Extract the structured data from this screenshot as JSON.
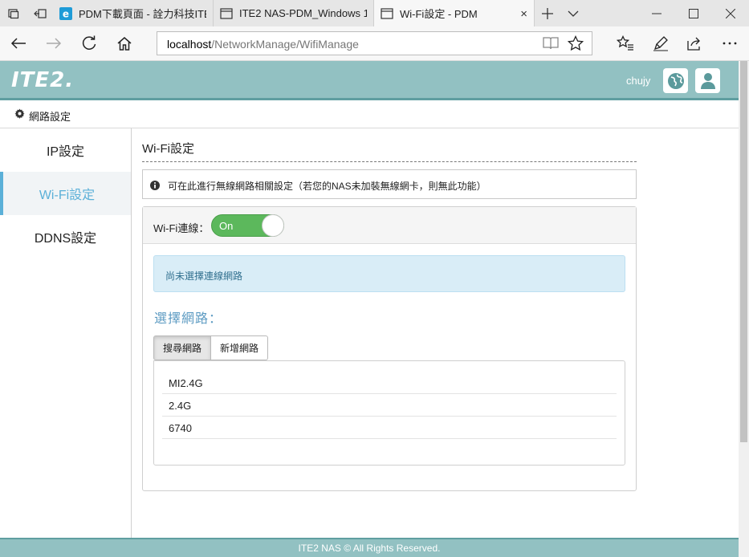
{
  "browser": {
    "tabs": [
      {
        "title": "PDM下載頁面 - 詮力科技ITE",
        "icon": "edge-favicon"
      },
      {
        "title": "ITE2 NAS-PDM_Windows 1(",
        "icon": "page-icon"
      },
      {
        "title": "Wi-Fi設定 - PDM",
        "icon": "page-icon",
        "active": true
      }
    ],
    "tab_close": "×",
    "new_tab": "+",
    "url_host": "localhost",
    "url_path": "/NetworkManage/WifiManage"
  },
  "header": {
    "logo": "ITE2.",
    "user": "chujy"
  },
  "breadcrumb": "網路設定",
  "sidebar": {
    "items": [
      {
        "label": "IP設定"
      },
      {
        "label": "Wi-Fi設定",
        "active": true
      },
      {
        "label": "DDNS設定"
      }
    ]
  },
  "main": {
    "title": "Wi-Fi設定",
    "info": "可在此進行無線網路相關設定（若您的NAS未加裝無線網卡，則無此功能）",
    "wifi_label": "Wi-Fi連線：",
    "wifi_state": "On",
    "alert": "尚未選擇連線網路",
    "section": "選擇網路：",
    "buttons": {
      "search": "搜尋網路",
      "add": "新增網路"
    },
    "networks": [
      "MI2.4G",
      "2.4G",
      "6740"
    ]
  },
  "footer": "ITE2 NAS © All Rights Reserved.",
  "colors": {
    "header": "#92c1c2",
    "accent": "#5bb0d8",
    "switch_on": "#5cb85c",
    "alert_bg": "#d9edf7"
  }
}
